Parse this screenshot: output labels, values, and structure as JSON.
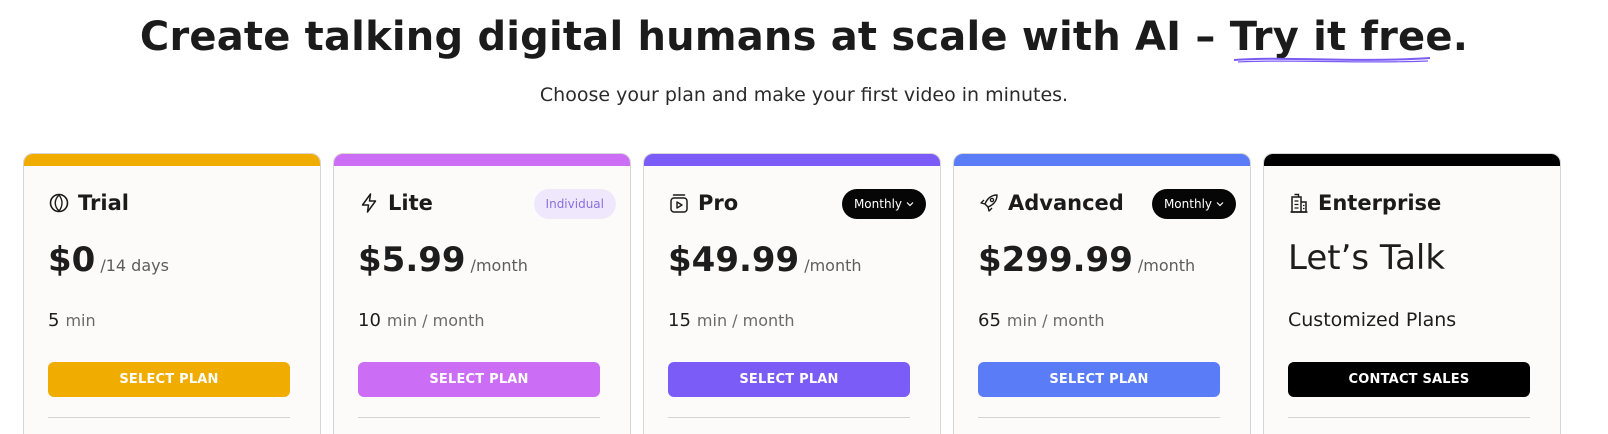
{
  "hero": {
    "headline_prefix": "Create talking digital humans at scale with AI – ",
    "headline_link": "Try it free",
    "headline_suffix": ".",
    "subheadline": "Choose your plan and make your first video in minutes."
  },
  "plans": [
    {
      "name": "Trial",
      "icon": "leaf-icon",
      "accent": "#f0ad00",
      "price": "$0",
      "period": "/14 days",
      "minutes": "5",
      "minutes_unit": "min",
      "cta": "SELECT PLAN"
    },
    {
      "name": "Lite",
      "icon": "lightning-icon",
      "accent": "#cc6ef5",
      "badge": "Individual",
      "price": "$5.99",
      "period": "/month",
      "minutes": "10",
      "minutes_unit": "min / month",
      "cta": "SELECT PLAN"
    },
    {
      "name": "Pro",
      "icon": "video-stack-icon",
      "accent": "#7b5cf7",
      "badge": "Monthly",
      "price": "$49.99",
      "period": "/month",
      "minutes": "15",
      "minutes_unit": "min / month",
      "cta": "SELECT PLAN"
    },
    {
      "name": "Advanced",
      "icon": "rocket-icon",
      "accent": "#5a7cf7",
      "badge": "Monthly",
      "price": "$299.99",
      "period": "/month",
      "minutes": "65",
      "minutes_unit": "min / month",
      "cta": "SELECT PLAN"
    },
    {
      "name": "Enterprise",
      "icon": "buildings-icon",
      "accent": "#000000",
      "headline": "Let’s Talk",
      "description": "Customized Plans",
      "cta": "CONTACT SALES"
    }
  ]
}
